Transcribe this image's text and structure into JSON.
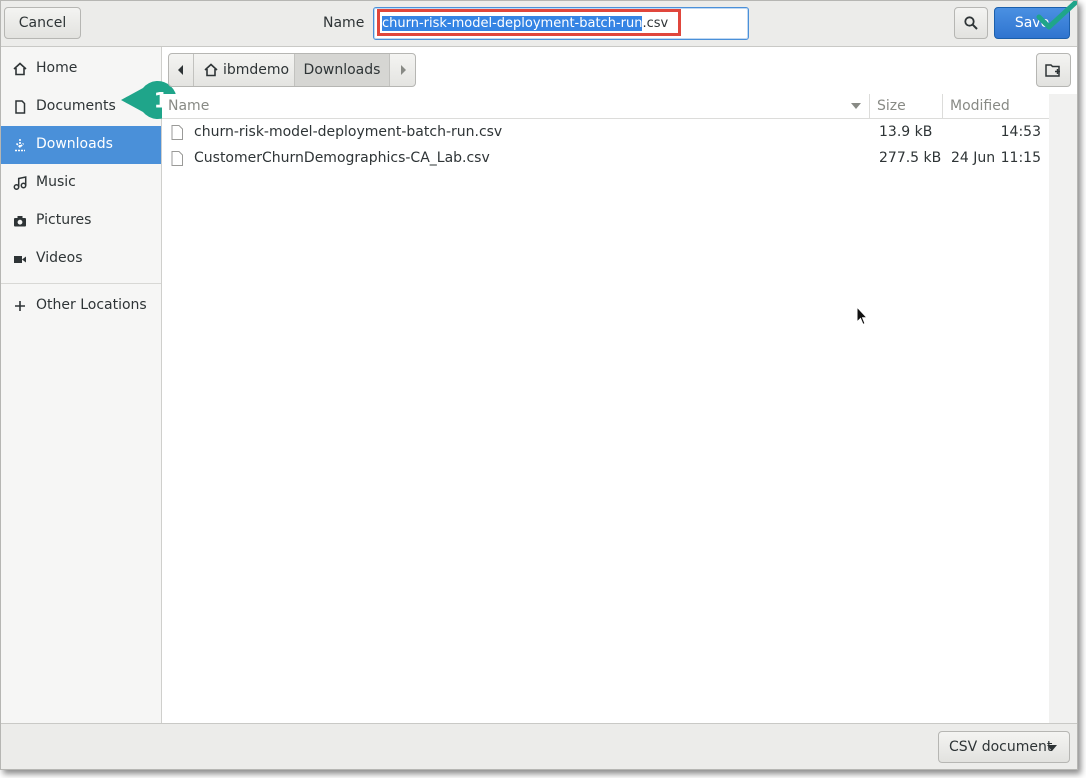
{
  "header": {
    "cancel_label": "Cancel",
    "name_label": "Name",
    "filename_selected": "churn-risk-model-deployment-batch-run",
    "filename_ext": ".csv",
    "save_label": "Save",
    "accent_color": "#3584e4",
    "highlight_color": "#e0463c"
  },
  "sidebar": {
    "items": [
      {
        "label": "Home",
        "icon": "home-icon"
      },
      {
        "label": "Documents",
        "icon": "document-icon"
      },
      {
        "label": "Downloads",
        "icon": "download-icon",
        "active": true
      },
      {
        "label": "Music",
        "icon": "music-icon"
      },
      {
        "label": "Pictures",
        "icon": "camera-icon"
      },
      {
        "label": "Videos",
        "icon": "video-icon"
      },
      {
        "label": "Other Locations",
        "icon": "plus-icon"
      }
    ],
    "callout_number": "1",
    "callout_color": "#1fa58a"
  },
  "pathbar": {
    "home_label": "ibmdemo",
    "current_label": "Downloads"
  },
  "filelist": {
    "columns": [
      "Name",
      "Size",
      "Modified"
    ],
    "rows": [
      {
        "name": "churn-risk-model-deployment-batch-run.csv",
        "size": "13.9 kB",
        "date": "",
        "time": "14:53"
      },
      {
        "name": "CustomerChurnDemographics-CA_Lab.csv",
        "size": "277.5 kB",
        "date": "24 Jun",
        "time": "11:15"
      }
    ]
  },
  "footer": {
    "filter_label": "CSV document"
  }
}
